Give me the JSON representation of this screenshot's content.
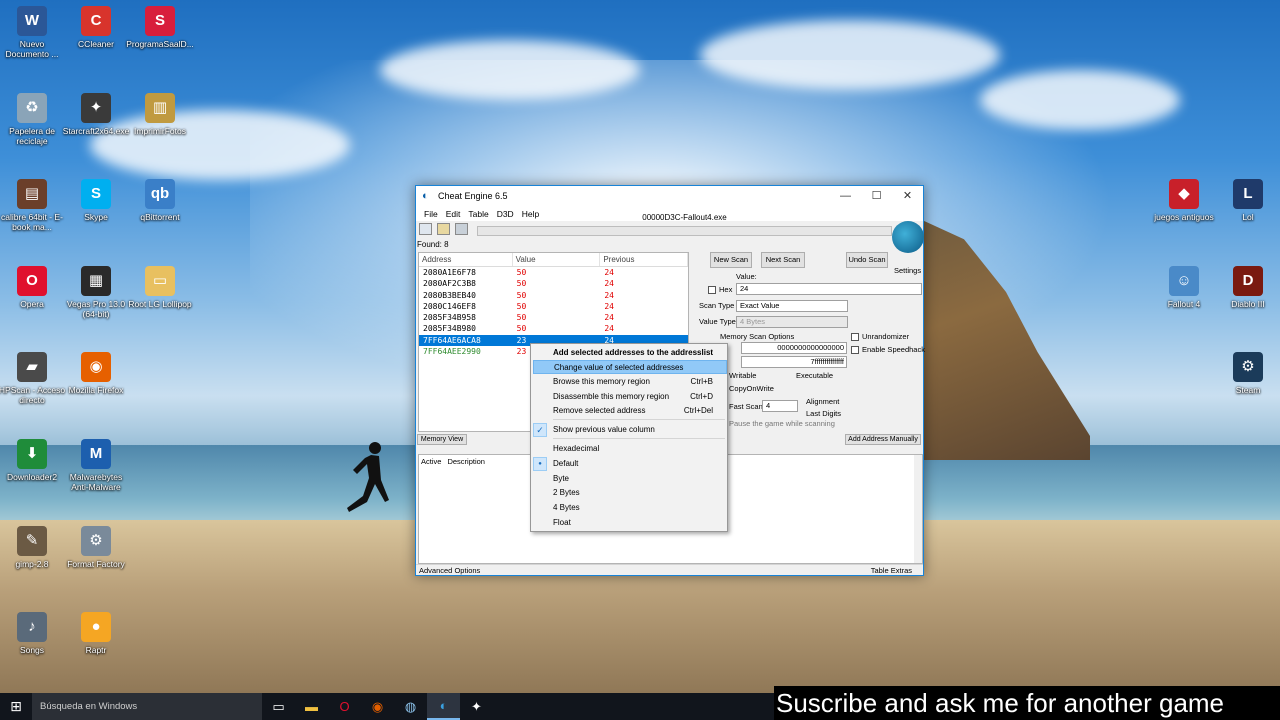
{
  "desktop": {
    "icons_left": [
      {
        "label": "Nuevo Documento ...",
        "icon": "word-icon",
        "color": "#2b5797",
        "glyph": "W"
      },
      {
        "label": "CCleaner",
        "icon": "ccleaner-icon",
        "color": "#d8342c",
        "glyph": "C"
      },
      {
        "label": "ProgramaSaalD...",
        "icon": "programa-s-icon",
        "color": "#d81e3c",
        "glyph": "S"
      },
      {
        "label": "Papelera de reciclaje",
        "icon": "recycle-bin-icon",
        "color": "#8aa4b8",
        "glyph": "♻"
      },
      {
        "label": "Starcraft2x64.exe",
        "icon": "starcraft-icon",
        "color": "#3a3a3a",
        "glyph": "✦"
      },
      {
        "label": "ImprimirFotos",
        "icon": "imprimir-fotos-icon",
        "color": "#c09a40",
        "glyph": "▥"
      },
      {
        "label": "calibre 64bit - E-book ma...",
        "icon": "calibre-icon",
        "color": "#6b3f2a",
        "glyph": "▤"
      },
      {
        "label": "Skype",
        "icon": "skype-icon",
        "color": "#00aff0",
        "glyph": "S"
      },
      {
        "label": "qBittorrent",
        "icon": "qbittorrent-icon",
        "color": "#3a7fc8",
        "glyph": "qb"
      },
      {
        "label": "Opera",
        "icon": "opera-icon",
        "color": "#e0102e",
        "glyph": "O"
      },
      {
        "label": "Vegas Pro 13.0 (64-bit)",
        "icon": "vegas-pro-icon",
        "color": "#2a2a2a",
        "glyph": "▦"
      },
      {
        "label": "Root LG Lollipop",
        "icon": "folder-icon",
        "color": "#e8c060",
        "glyph": "▭"
      },
      {
        "label": "HPScan - Acceso directo",
        "icon": "hpscan-icon",
        "color": "#4a4a4a",
        "glyph": "▰"
      },
      {
        "label": "Mozilla Firefox",
        "icon": "firefox-icon",
        "color": "#e66000",
        "glyph": "◉"
      },
      {
        "label": "Downloader2",
        "icon": "downloader-icon",
        "color": "#1f8c3a",
        "glyph": "⬇"
      },
      {
        "label": "Malwarebytes Anti-Malware",
        "icon": "malwarebytes-icon",
        "color": "#1d5fae",
        "glyph": "M"
      },
      {
        "label": "gimp-2.8",
        "icon": "gimp-icon",
        "color": "#6b5a44",
        "glyph": "✎"
      },
      {
        "label": "Format Factory",
        "icon": "format-factory-icon",
        "color": "#7a8a9a",
        "glyph": "⚙"
      },
      {
        "label": "Songs",
        "icon": "songs-icon",
        "color": "#5a6a7a",
        "glyph": "♪"
      },
      {
        "label": "Raptr",
        "icon": "raptr-icon",
        "color": "#f5a623",
        "glyph": "●"
      }
    ],
    "icons_right": [
      {
        "label": "juegos antiguos",
        "icon": "juegos-antiguos-icon",
        "color": "#c8202a",
        "glyph": "◆"
      },
      {
        "label": "Lol",
        "icon": "lol-icon",
        "color": "#1f3a6a",
        "glyph": "L"
      },
      {
        "label": "Fallout 4",
        "icon": "fallout4-icon",
        "color": "#4a8ac8",
        "glyph": "☺"
      },
      {
        "label": "Diablo III",
        "icon": "diablo-icon",
        "color": "#7a1a10",
        "glyph": "D"
      },
      {
        "label": "Steam",
        "icon": "steam-icon",
        "color": "#1b3b5a",
        "glyph": "⚙"
      }
    ]
  },
  "cheat_engine": {
    "title": "Cheat Engine 6.5",
    "menu": [
      "File",
      "Edit",
      "Table",
      "D3D",
      "Help"
    ],
    "process": "00000D3C-Fallout4.exe",
    "found": "Found: 8",
    "columns": [
      "Address",
      "Value",
      "Previous"
    ],
    "rows": [
      {
        "address": "2080A1E6F78",
        "value": "50",
        "previous": "24"
      },
      {
        "address": "2080AF2C3B8",
        "value": "50",
        "previous": "24"
      },
      {
        "address": "2080B3BEB40",
        "value": "50",
        "previous": "24"
      },
      {
        "address": "2080C146EF8",
        "value": "50",
        "previous": "24"
      },
      {
        "address": "2085F34B958",
        "value": "50",
        "previous": "24"
      },
      {
        "address": "2085F34B980",
        "value": "50",
        "previous": "24"
      },
      {
        "address": "7FF64AE6ACA8",
        "value": "23",
        "previous": "24"
      },
      {
        "address": "7FF64AEE2990",
        "value": "23",
        "previous": "24"
      }
    ],
    "buttons": {
      "new_scan": "New Scan",
      "next_scan": "Next Scan",
      "undo_scan": "Undo Scan",
      "settings": "Settings"
    },
    "value_label": "Value:",
    "hex_label": "Hex",
    "value_input": "24",
    "scan_type_label": "Scan Type",
    "scan_type": "Exact Value",
    "value_type_label": "Value Type",
    "value_type": "4 Bytes",
    "memory_scan_options": "Memory Scan Options",
    "start_address": "0000000000000000",
    "stop_address": "7fffffffffffffff",
    "writable": "Writable",
    "executable": "Executable",
    "copy_on_write": "CopyOnWrite",
    "fast_scan": "Fast Scan",
    "fast_scan_value": "4",
    "alignment": "Alignment",
    "last_digits": "Last Digits",
    "pause_game": "Pause the game while scanning",
    "unrandomizer": "Unrandomizer",
    "speedhack": "Enable Speedhack",
    "memory_view": "Memory View",
    "add_address_manually": "Add Address Manually",
    "list_columns": [
      "Active",
      "Description"
    ],
    "advanced_options": "Advanced Options",
    "table_extras": "Table Extras"
  },
  "context_menu": {
    "items": [
      {
        "label": "Add selected addresses to the addresslist",
        "shortcut": "",
        "bold": true
      },
      {
        "label": "Change value of selected addresses",
        "shortcut": "",
        "highlight": true
      },
      {
        "label": "Browse this memory region",
        "shortcut": "Ctrl+B"
      },
      {
        "label": "Disassemble this memory region",
        "shortcut": "Ctrl+D"
      },
      {
        "label": "Remove selected address",
        "shortcut": "Ctrl+Del"
      },
      {
        "label": "Show previous value column",
        "shortcut": "",
        "checked": true
      },
      {
        "label": "Hexadecimal",
        "shortcut": ""
      },
      {
        "label": "Default",
        "shortcut": "",
        "radio": true
      },
      {
        "label": "Byte",
        "shortcut": ""
      },
      {
        "label": "2 Bytes",
        "shortcut": ""
      },
      {
        "label": "4 Bytes",
        "shortcut": ""
      },
      {
        "label": "Float",
        "shortcut": ""
      }
    ]
  },
  "taskbar": {
    "search_placeholder": "Búsqueda en Windows",
    "subtitle": "Suscribe and ask me for another game"
  }
}
